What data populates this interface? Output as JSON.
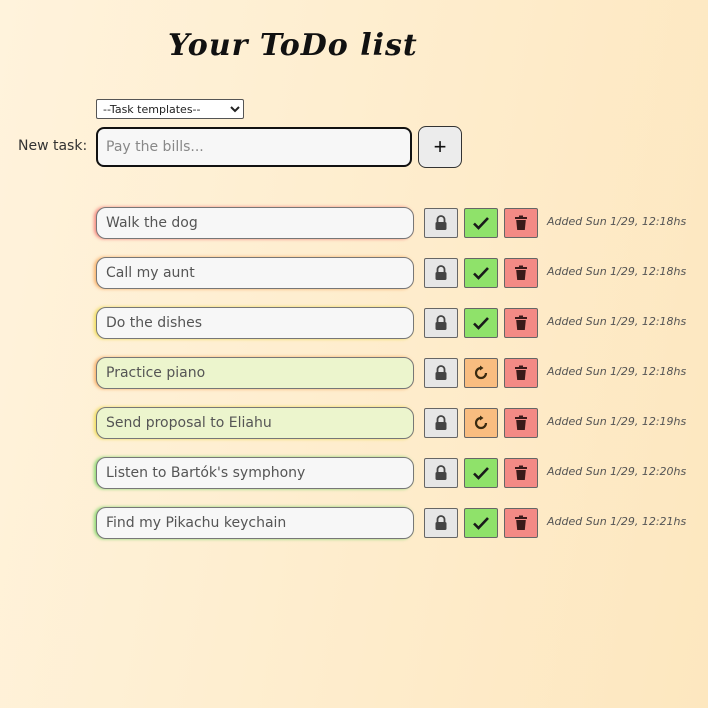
{
  "title": "Your ToDo list",
  "templates": {
    "selected": "--Task templates--"
  },
  "new_task": {
    "label": "New task:",
    "placeholder": "Pay the bills...",
    "add_label": "+"
  },
  "tasks": [
    {
      "text": "Walk the dog",
      "status": "done",
      "color": "#f05a5a",
      "added": "Added Sun 1/29, 12:18hs"
    },
    {
      "text": "Call my aunt",
      "status": "done",
      "color": "#f5963c",
      "added": "Added Sun 1/29, 12:18hs"
    },
    {
      "text": "Do the dishes",
      "status": "done",
      "color": "#ebd73c",
      "added": "Added Sun 1/29, 12:18hs"
    },
    {
      "text": "Practice piano",
      "status": "in-progress",
      "color": "#f5963c",
      "added": "Added Sun 1/29, 12:18hs"
    },
    {
      "text": "Send proposal to Eliahu",
      "status": "in-progress",
      "color": "#ebd73c",
      "added": "Added Sun 1/29, 12:19hs"
    },
    {
      "text": "Listen to Bartók's symphony",
      "status": "done",
      "color": "#6ed25a",
      "added": "Added Sun 1/29, 12:20hs"
    },
    {
      "text": "Find my Pikachu keychain",
      "status": "done",
      "color": "#6ed25a",
      "added": "Added Sun 1/29, 12:21hs"
    }
  ],
  "icons": {
    "lock": "lock-icon",
    "done": "check-icon",
    "in_progress": "refresh-icon",
    "delete": "trash-icon"
  }
}
